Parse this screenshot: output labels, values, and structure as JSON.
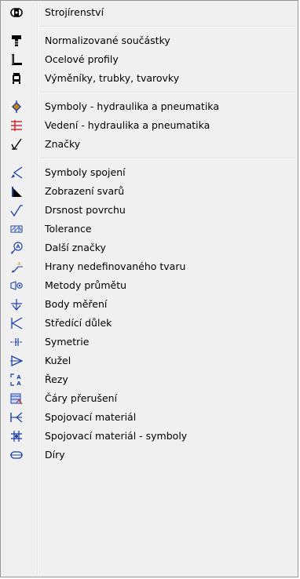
{
  "menu": {
    "items": [
      {
        "label": "Strojírenství",
        "icon": "machine-part-icon"
      },
      {
        "label": "Normalizované součástky",
        "icon": "bolt-icon"
      },
      {
        "label": "Ocelové profily",
        "icon": "steel-profile-icon"
      },
      {
        "label": "Výměníky, trubky, tvarovky",
        "icon": "exchanger-icon"
      },
      {
        "label": "Symboly - hydraulika a pneumatika",
        "icon": "hydraulic-symbol-icon"
      },
      {
        "label": "Vedení - hydraulika a pneumatika",
        "icon": "hydraulic-line-icon"
      },
      {
        "label": "Značky",
        "icon": "mark-icon"
      },
      {
        "label": "Symboly spojení",
        "icon": "joint-symbol-icon"
      },
      {
        "label": "Zobrazení svarů",
        "icon": "weld-icon"
      },
      {
        "label": "Drsnost povrchu",
        "icon": "surface-roughness-icon"
      },
      {
        "label": "Tolerance",
        "icon": "tolerance-icon"
      },
      {
        "label": "Další značky",
        "icon": "other-marks-icon"
      },
      {
        "label": "Hrany nedefinovaného tvaru",
        "icon": "undefined-edge-icon"
      },
      {
        "label": "Metody průmětu",
        "icon": "projection-method-icon"
      },
      {
        "label": "Body měření",
        "icon": "measuring-point-icon"
      },
      {
        "label": "Středící důlek",
        "icon": "center-hole-icon"
      },
      {
        "label": "Symetrie",
        "icon": "symmetry-icon"
      },
      {
        "label": "Kužel",
        "icon": "cone-icon"
      },
      {
        "label": "Řezy",
        "icon": "section-icon"
      },
      {
        "label": "Čáry přerušení",
        "icon": "break-line-icon"
      },
      {
        "label": "Spojovací materiál",
        "icon": "fastener-icon"
      },
      {
        "label": "Spojovací materiál - symboly",
        "icon": "fastener-symbol-icon"
      },
      {
        "label": "Díry",
        "icon": "hole-icon"
      }
    ]
  },
  "colors": {
    "accent": "#1c3fa8",
    "red": "#d42020",
    "orange": "#c8880a"
  }
}
